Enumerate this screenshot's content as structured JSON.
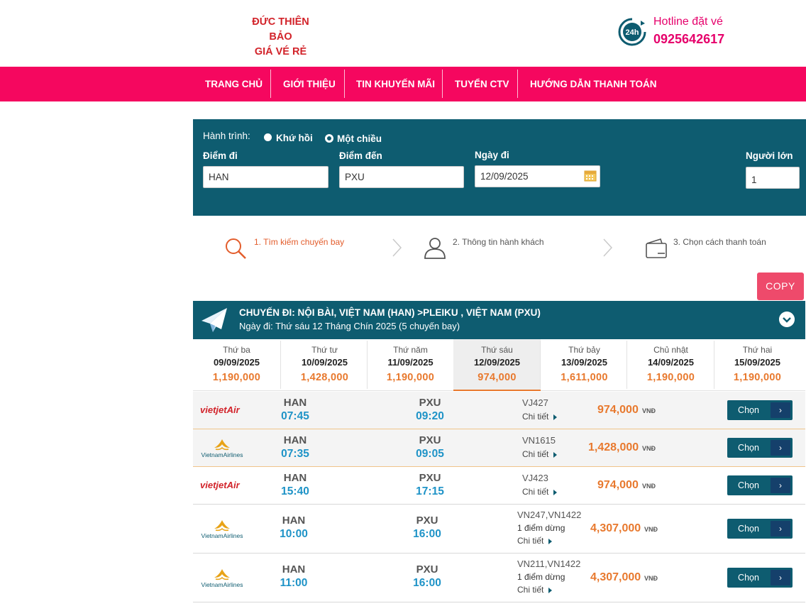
{
  "header": {
    "brand_line1": "ĐỨC THIÊN BẢO",
    "brand_line2": "GIÁ VÉ RẺ",
    "hotline_icon_text": "24h",
    "hotline_label": "Hotline đặt vé",
    "hotline_number": "0925642617"
  },
  "nav": {
    "items": [
      "TRANG CHỦ",
      "GIỚI THIỆU",
      "TIN KHUYẾN MÃI",
      "TUYỂN CTV",
      "HƯỚNG DẪN THANH TOÁN"
    ]
  },
  "search": {
    "trip_label": "Hành trình:",
    "round_trip": "Khứ hồi",
    "one_way": "Một chiều",
    "selected_trip": "one_way",
    "from_label": "Điểm đi",
    "from_value": "HAN",
    "to_label": "Điểm đến",
    "to_value": "PXU",
    "date_label": "Ngày đi",
    "date_value": "12/09/2025",
    "adults_label": "Người lớn",
    "adults_value": "1"
  },
  "steps": [
    {
      "label": "1. Tìm kiếm chuyến bay",
      "icon": "search-icon",
      "active": true
    },
    {
      "label": "2. Thông tin hành khách",
      "icon": "user-icon",
      "active": false
    },
    {
      "label": "3. Chọn cách thanh toán",
      "icon": "wallet-icon",
      "active": false
    }
  ],
  "copy_button": "COPY",
  "flight_header": {
    "title": "CHUYẾN ĐI: NỘI BÀI, VIỆT NAM (HAN) >PLEIKU , VIỆT NAM (PXU)",
    "subtitle": "Ngày đi: Thứ sáu 12 Tháng Chín 2025 (5 chuyến bay)"
  },
  "dates": [
    {
      "weekday": "Thứ ba",
      "date": "09/09/2025",
      "price": "1,190,000",
      "active": false
    },
    {
      "weekday": "Thứ tư",
      "date": "10/09/2025",
      "price": "1,428,000",
      "active": false
    },
    {
      "weekday": "Thứ năm",
      "date": "11/09/2025",
      "price": "1,190,000",
      "active": false
    },
    {
      "weekday": "Thứ sáu",
      "date": "12/09/2025",
      "price": "974,000",
      "active": true
    },
    {
      "weekday": "Thứ bảy",
      "date": "13/09/2025",
      "price": "1,611,000",
      "active": false
    },
    {
      "weekday": "Chủ nhật",
      "date": "14/09/2025",
      "price": "1,190,000",
      "active": false
    },
    {
      "weekday": "Thứ hai",
      "date": "15/09/2025",
      "price": "1,190,000",
      "active": false
    }
  ],
  "flights": [
    {
      "airline": "vietjet",
      "logo_text": "vietjetAir",
      "from": "HAN",
      "dep": "07:45",
      "to": "PXU",
      "arr": "09:20",
      "code": "VJ427",
      "stops": "",
      "detail": "Chi tiết",
      "price": "974,000",
      "currency": "VNĐ",
      "button": "Chọn",
      "highlight": true
    },
    {
      "airline": "vietnam",
      "logo_text": "VietnamAirlines",
      "from": "HAN",
      "dep": "07:35",
      "to": "PXU",
      "arr": "09:05",
      "code": "VN1615",
      "stops": "",
      "detail": "Chi tiết",
      "price": "1,428,000",
      "currency": "VNĐ",
      "button": "Chọn",
      "highlight": true
    },
    {
      "airline": "vietjet",
      "logo_text": "vietjetAir",
      "from": "HAN",
      "dep": "15:40",
      "to": "PXU",
      "arr": "17:15",
      "code": "VJ423",
      "stops": "",
      "detail": "Chi tiết",
      "price": "974,000",
      "currency": "VNĐ",
      "button": "Chọn",
      "highlight": false
    },
    {
      "airline": "vietnam",
      "logo_text": "VietnamAirlines",
      "from": "HAN",
      "dep": "10:00",
      "to": "PXU",
      "arr": "16:00",
      "code": "VN247,VN1422",
      "stops": "1 điểm dừng",
      "detail": "Chi tiết",
      "price": "4,307,000",
      "currency": "VNĐ",
      "button": "Chọn",
      "highlight": false
    },
    {
      "airline": "vietnam",
      "logo_text": "VietnamAirlines",
      "from": "HAN",
      "dep": "11:00",
      "to": "PXU",
      "arr": "16:00",
      "code": "VN211,VN1422",
      "stops": "1 điểm dừng",
      "detail": "Chi tiết",
      "price": "4,307,000",
      "currency": "VNĐ",
      "button": "Chọn",
      "highlight": false
    }
  ]
}
